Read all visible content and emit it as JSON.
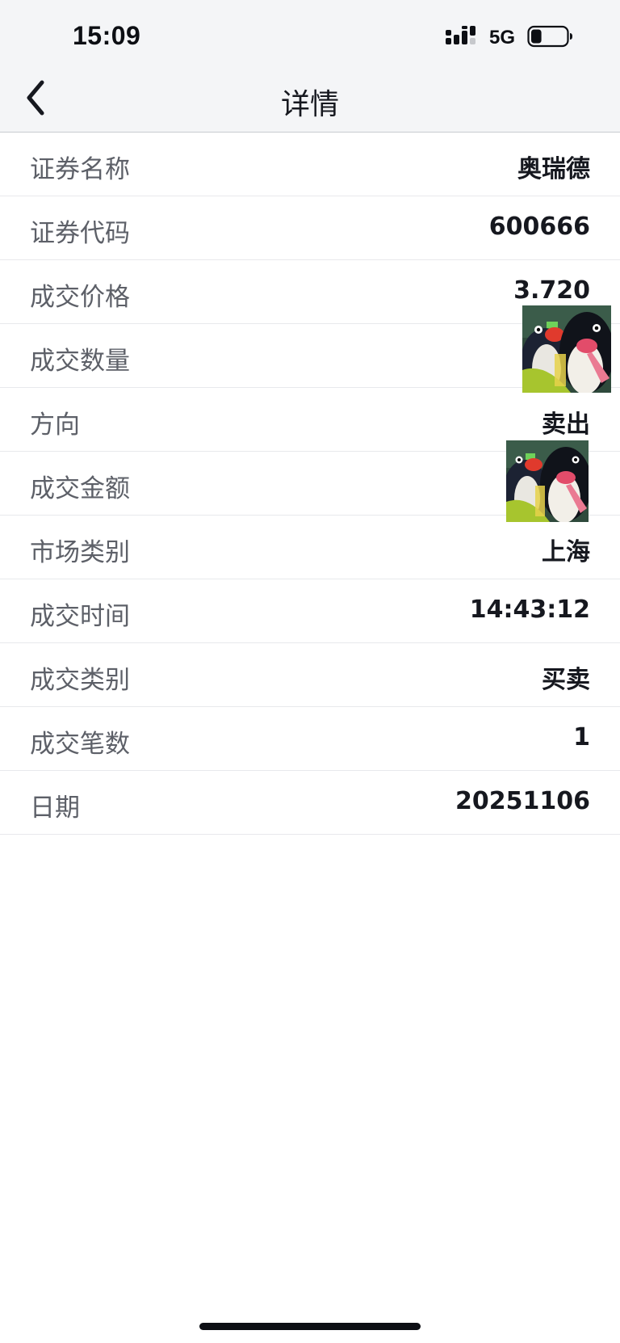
{
  "status_bar": {
    "time": "15:09",
    "network": "5G",
    "signal_icon": "cellular-signal-icon",
    "battery_icon": "battery-icon",
    "battery_level": 0.3
  },
  "header": {
    "title": "详情",
    "back_icon": "chevron-left-icon"
  },
  "details": [
    {
      "label": "证券名称",
      "value": "奥瑞德"
    },
    {
      "label": "证券代码",
      "value": "600666"
    },
    {
      "label": "成交价格",
      "value": "3.720"
    },
    {
      "label": "成交数量",
      "value": ""
    },
    {
      "label": "方向",
      "value": "卖出"
    },
    {
      "label": "成交金额",
      "value": ""
    },
    {
      "label": "市场类别",
      "value": "上海"
    },
    {
      "label": "成交时间",
      "value": "14:43:12"
    },
    {
      "label": "成交类别",
      "value": "买卖"
    },
    {
      "label": "成交笔数",
      "value": "1"
    },
    {
      "label": "日期",
      "value": "20251106"
    }
  ],
  "colors": {
    "header_bg": "#f4f5f7",
    "label": "#5d6068",
    "value": "#16181f",
    "divider": "#e8e9ec"
  }
}
